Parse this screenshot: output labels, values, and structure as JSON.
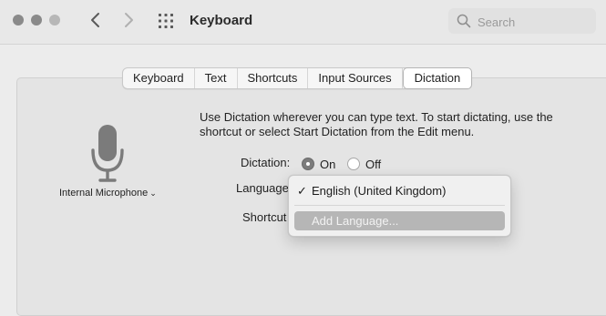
{
  "window": {
    "title": "Keyboard"
  },
  "search": {
    "placeholder": "Search"
  },
  "tabs": [
    {
      "label": "Keyboard",
      "active": false
    },
    {
      "label": "Text",
      "active": false
    },
    {
      "label": "Shortcuts",
      "active": false
    },
    {
      "label": "Input Sources",
      "active": false
    },
    {
      "label": "Dictation",
      "active": true
    }
  ],
  "microphone": {
    "source_label": "Internal Microphone"
  },
  "description": "Use Dictation wherever you can type text. To start dictating, use the shortcut or select Start Dictation from the Edit menu.",
  "dictation": {
    "label": "Dictation:",
    "on_label": "On",
    "off_label": "Off",
    "value": "On"
  },
  "language": {
    "label": "Language"
  },
  "shortcut": {
    "label": "Shortcut"
  },
  "language_menu": {
    "items": [
      {
        "label": "English (United Kingdom)",
        "checked": true
      },
      {
        "label": "Add Language...",
        "highlighted": true
      }
    ]
  },
  "colors": {
    "accent_gray": "#7c7c7c",
    "menu_highlight": "#b6b6b6"
  }
}
